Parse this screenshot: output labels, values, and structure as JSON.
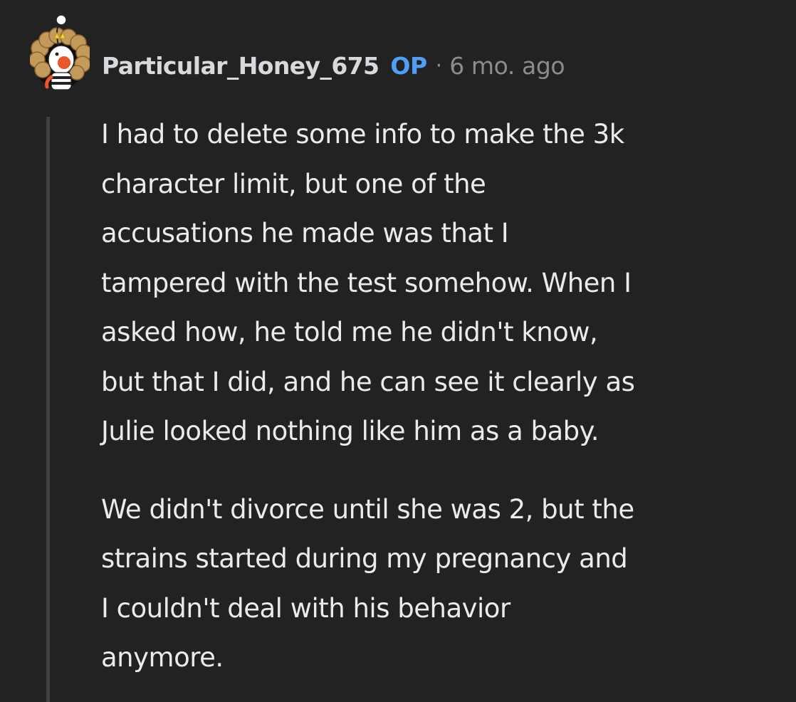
{
  "comment": {
    "author": "Particular_Honey_675",
    "op_badge": "OP",
    "separator": "·",
    "timestamp": "6 mo. ago",
    "avatar_icon": "snoo-avatar-icon",
    "paragraphs": [
      "I had to delete some info to make the 3k\ncharacter limit, but one of the\naccusations he made was that I\ntampered with the test somehow. When I\nasked how, he told me he didn't know,\nbut that I did, and he can see it clearly as\nJulie looked nothing like him as a baby.",
      "We didn't divorce until she was 2, but the\nstrains started during my pregnancy and\nI couldn't deal with his behavior\nanymore."
    ]
  },
  "colors": {
    "background": "#222223",
    "text": "#e9ebec",
    "username": "#d7dadc",
    "op_badge": "#4fa0f5",
    "meta": "#8a8d90",
    "thread_line": "#3e4042"
  }
}
